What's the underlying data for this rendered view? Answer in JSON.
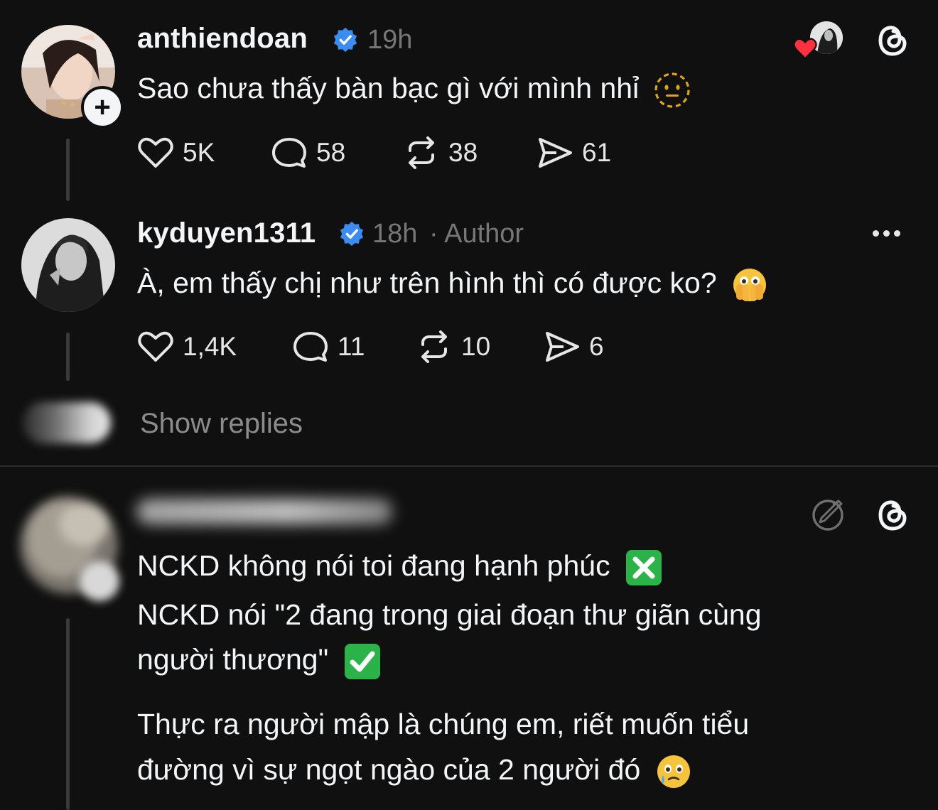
{
  "posts": [
    {
      "username": "anthiendoan",
      "time": "19h",
      "text": "Sao chưa thấy bàn bạc gì với mình nhỉ",
      "emoji_icon": "dotted-line-face-emoji",
      "likes": "5K",
      "comments": "58",
      "reposts": "38",
      "shares": "61"
    },
    {
      "username": "kyduyen1311",
      "time": "18h",
      "author_tag": "· Author",
      "text": "À, em thấy chị như trên hình thì có được ko?",
      "emoji_icon": "face-with-open-eyes-and-hand-over-mouth-emoji",
      "likes": "1,4K",
      "comments": "11",
      "reposts": "10",
      "shares": "6"
    }
  ],
  "show_replies": "Show replies",
  "third_post": {
    "username_hidden": true,
    "lines": [
      "NCKD không nói toi đang hạnh phúc",
      "NCKD nói \"2 đang trong giai đoạn thư giãn cùng",
      "người thương\"",
      "Thực ra người mập là chúng em, riết muốn tiểu",
      "đường vì sự ngọt ngào của 2 người đó"
    ],
    "line1_emoji": "cross-mark-emoji",
    "line3_emoji": "check-mark-emoji",
    "line5_emoji": "face-holding-back-tears-emoji"
  },
  "colors": {
    "background": "#101010",
    "text": "#f3f5f7",
    "muted": "#777777",
    "verified": "#3d8cf2",
    "heart": "#ff3040"
  }
}
